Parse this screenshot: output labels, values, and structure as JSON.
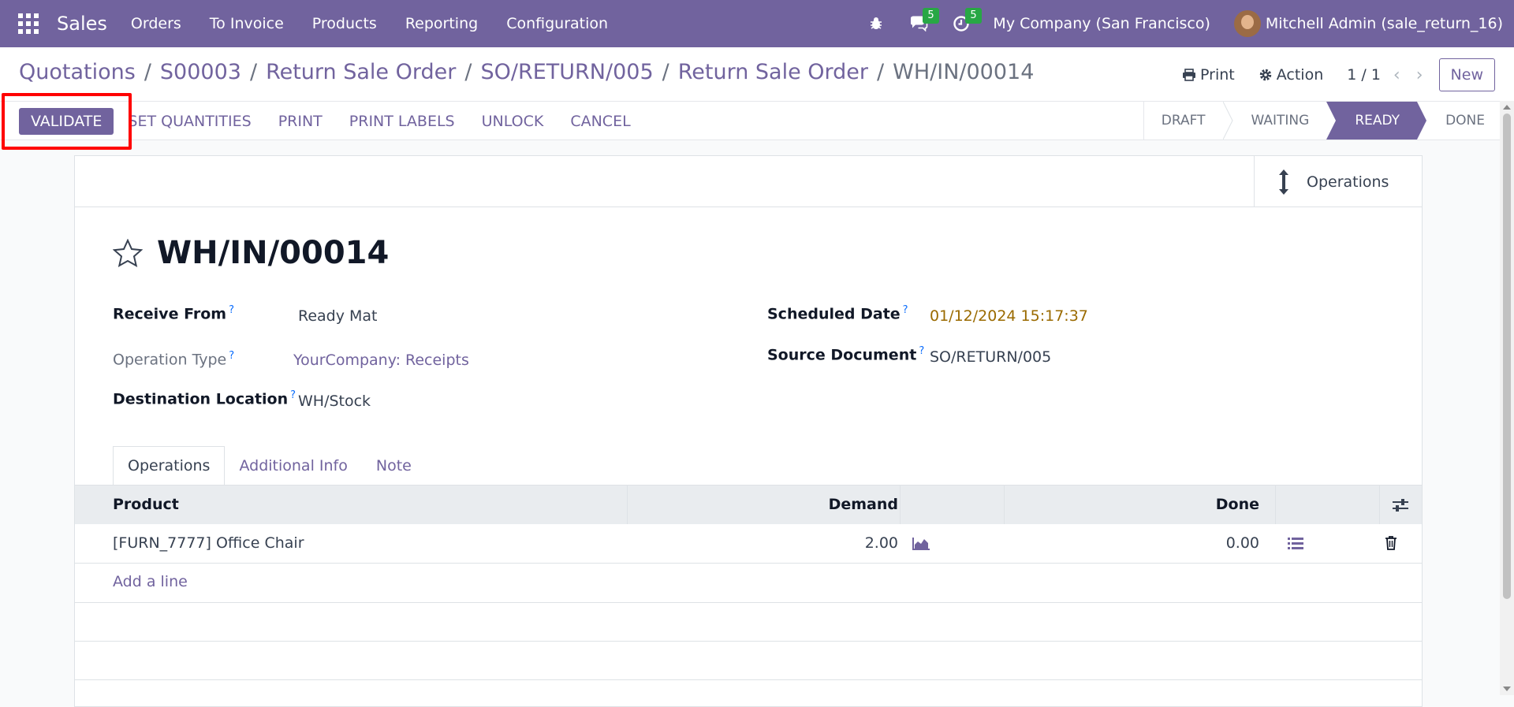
{
  "topbar": {
    "app_name": "Sales",
    "menu": [
      "Orders",
      "To Invoice",
      "Products",
      "Reporting",
      "Configuration"
    ],
    "messages_count": "5",
    "activities_count": "5",
    "company": "My Company (San Francisco)",
    "user": "Mitchell Admin (sale_return_16)",
    "color": "#71639e"
  },
  "breadcrumbs": [
    "Quotations",
    "S00003",
    "Return Sale Order",
    "SO/RETURN/005",
    "Return Sale Order",
    "WH/IN/00014"
  ],
  "control_panel": {
    "print_label": "Print",
    "action_label": "Action",
    "pager": "1 / 1",
    "new_label": "New"
  },
  "actions": {
    "validate": "VALIDATE",
    "set_quantities": "SET QUANTITIES",
    "print": "PRINT",
    "print_labels": "PRINT LABELS",
    "unlock": "UNLOCK",
    "cancel": "CANCEL"
  },
  "stages": [
    "DRAFT",
    "WAITING",
    "READY",
    "DONE"
  ],
  "active_stage": "READY",
  "smart_button": "Operations",
  "record": {
    "title": "WH/IN/00014",
    "receive_from_label": "Receive From",
    "receive_from": "Ready Mat",
    "operation_type_label": "Operation Type",
    "operation_type": "YourCompany: Receipts",
    "destination_label": "Destination Location",
    "destination": "WH/Stock",
    "scheduled_date_label": "Scheduled Date",
    "scheduled_date": "01/12/2024 15:17:37",
    "source_document_label": "Source Document",
    "source_document": "SO/RETURN/005",
    "help_mark": "?"
  },
  "tabs": [
    "Operations",
    "Additional Info",
    "Note"
  ],
  "table": {
    "headers": {
      "product": "Product",
      "demand": "Demand",
      "done": "Done"
    },
    "rows": [
      {
        "product": "[FURN_7777] Office Chair",
        "demand": "2.00",
        "done": "0.00"
      }
    ],
    "add_line": "Add a line"
  }
}
